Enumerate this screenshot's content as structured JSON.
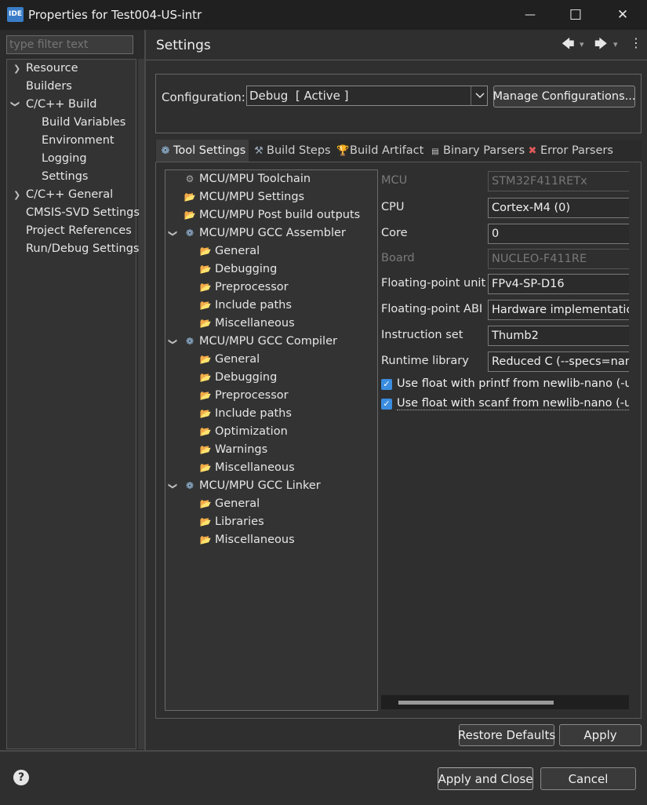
{
  "window": {
    "app_icon_text": "IDE",
    "title": "Properties for Test004-US-intr",
    "minimize_glyph": "—",
    "maximize_glyph": "☐",
    "close_glyph": "✕"
  },
  "sidebar": {
    "filter_placeholder": "type filter text",
    "items": [
      {
        "label": "Resource"
      },
      {
        "label": "Builders"
      },
      {
        "label": "C/C++ Build"
      },
      {
        "label": "Build Variables"
      },
      {
        "label": "Environment"
      },
      {
        "label": "Logging"
      },
      {
        "label": "Settings"
      },
      {
        "label": "C/C++ General"
      },
      {
        "label": "CMSIS-SVD Settings"
      },
      {
        "label": "Project References"
      },
      {
        "label": "Run/Debug Settings"
      }
    ]
  },
  "header": {
    "title": "Settings",
    "back_glyph": "🡄",
    "forward_glyph": "🡆",
    "menu_glyph": "⋮",
    "dropdown_glyph": "▾"
  },
  "configuration": {
    "label": "Configuration:",
    "value": "Debug  [ Active ]",
    "manage_button": "Manage Configurations..."
  },
  "tabs": [
    {
      "label": "Tool Settings",
      "icon": "gear-icon"
    },
    {
      "label": "Build Steps",
      "icon": "hammer-icon"
    },
    {
      "label": "Build Artifact",
      "icon": "trophy-icon"
    },
    {
      "label": "Binary Parsers",
      "icon": "binary-icon"
    },
    {
      "label": "Error Parsers",
      "icon": "error-icon"
    }
  ],
  "tool_tree": {
    "items": [
      {
        "label": "MCU/MPU Toolchain"
      },
      {
        "label": "MCU/MPU Settings"
      },
      {
        "label": "MCU/MPU Post build outputs"
      },
      {
        "label": "MCU/MPU GCC Assembler"
      },
      {
        "label": "General"
      },
      {
        "label": "Debugging"
      },
      {
        "label": "Preprocessor"
      },
      {
        "label": "Include paths"
      },
      {
        "label": "Miscellaneous"
      },
      {
        "label": "MCU/MPU GCC Compiler"
      },
      {
        "label": "General"
      },
      {
        "label": "Debugging"
      },
      {
        "label": "Preprocessor"
      },
      {
        "label": "Include paths"
      },
      {
        "label": "Optimization"
      },
      {
        "label": "Warnings"
      },
      {
        "label": "Miscellaneous"
      },
      {
        "label": "MCU/MPU GCC Linker"
      },
      {
        "label": "General"
      },
      {
        "label": "Libraries"
      },
      {
        "label": "Miscellaneous"
      }
    ]
  },
  "properties": {
    "mcu": {
      "label": "MCU",
      "value": "STM32F411RETx"
    },
    "cpu": {
      "label": "CPU",
      "value": "Cortex-M4 (0)"
    },
    "core": {
      "label": "Core",
      "value": "0"
    },
    "board": {
      "label": "Board",
      "value": "NUCLEO-F411RE"
    },
    "fpu": {
      "label": "Floating-point unit",
      "value": "FPv4-SP-D16"
    },
    "fpabi": {
      "label": "Floating-point ABI",
      "value": "Hardware implementation"
    },
    "iset": {
      "label": "Instruction set",
      "value": "Thumb2"
    },
    "runtime": {
      "label": "Runtime library",
      "value": "Reduced C (--specs=nano"
    },
    "printf_float": {
      "label": "Use float with printf from newlib-nano (-u _",
      "checked": true
    },
    "scanf_float": {
      "label": "Use float with scanf from newlib-nano (-u _",
      "checked": true
    }
  },
  "buttons": {
    "restore_defaults": "Restore Defaults",
    "apply": "Apply",
    "apply_close": "Apply and Close",
    "cancel": "Cancel"
  },
  "help_glyph": "?",
  "colors": {
    "background": "#2f2f2f",
    "titlebar": "#202020",
    "checkbox": "#3b8de0",
    "folder_icon": "#e9c46a",
    "gear_icon": "#9fc6ea"
  }
}
